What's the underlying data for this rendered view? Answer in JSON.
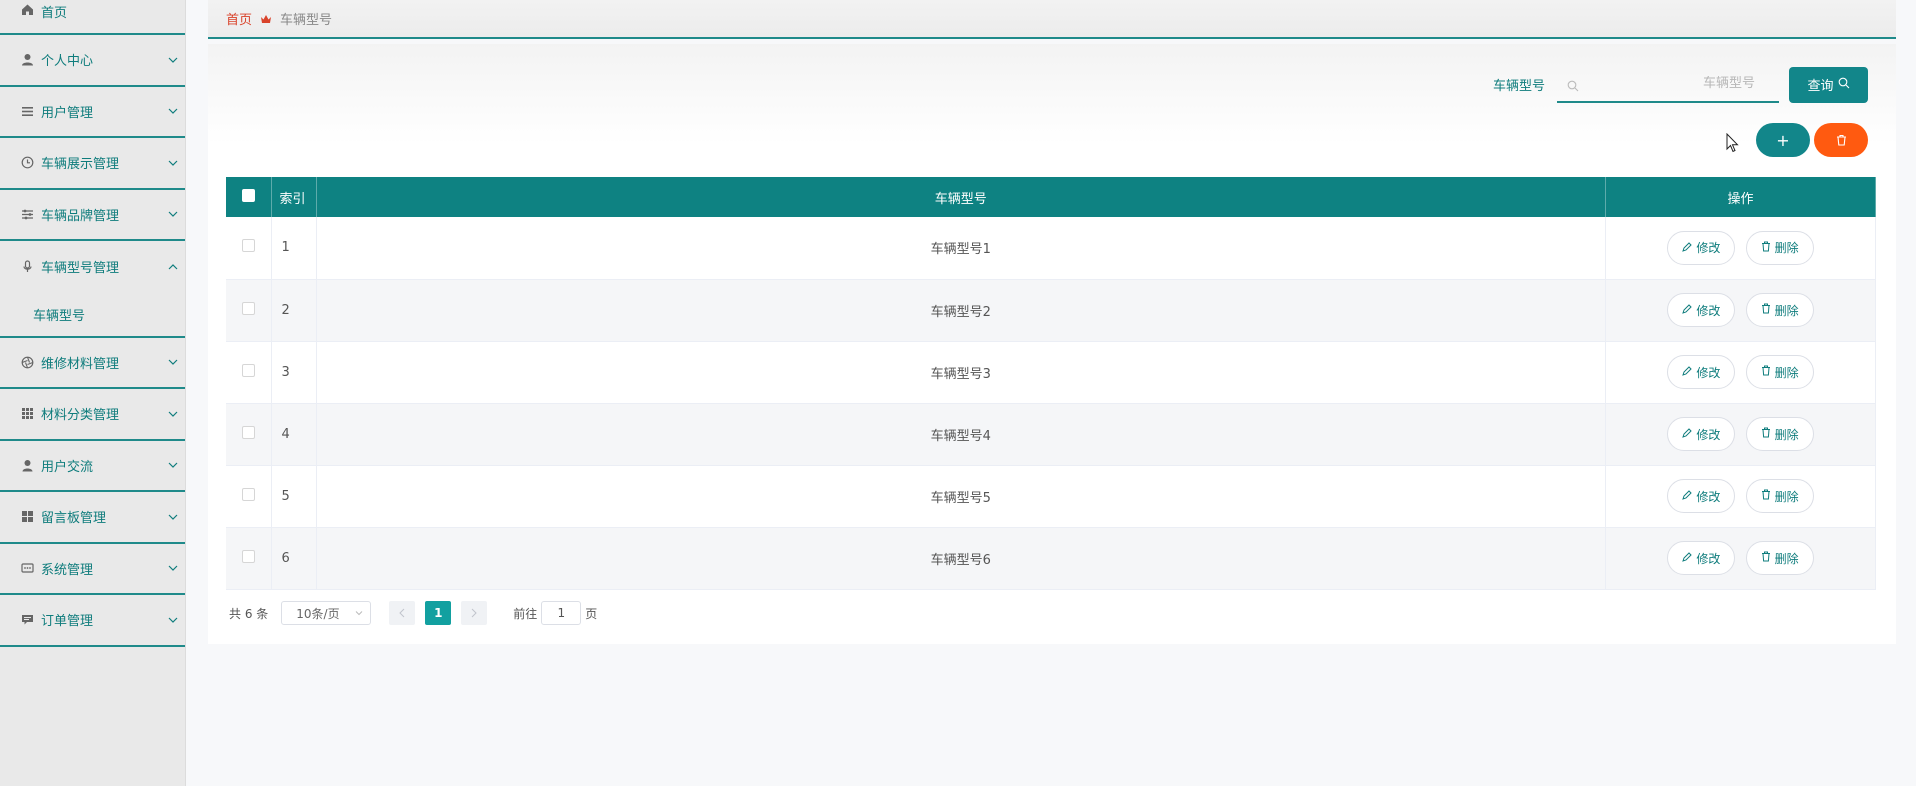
{
  "sidebar": {
    "items": [
      {
        "label": "首页",
        "icon": "home-icon"
      },
      {
        "label": "个人中心",
        "icon": "user-icon"
      },
      {
        "label": "用户管理",
        "icon": "menu-icon"
      },
      {
        "label": "车辆展示管理",
        "icon": "clock-icon"
      },
      {
        "label": "车辆品牌管理",
        "icon": "sliders-icon"
      },
      {
        "label": "车辆型号管理",
        "icon": "microphone-icon",
        "expanded": true,
        "children": [
          {
            "label": "车辆型号"
          }
        ]
      },
      {
        "label": "维修材料管理",
        "icon": "aperture-icon"
      },
      {
        "label": "材料分类管理",
        "icon": "grid-icon"
      },
      {
        "label": "用户交流",
        "icon": "person-icon"
      },
      {
        "label": "留言板管理",
        "icon": "tiles-icon"
      },
      {
        "label": "系统管理",
        "icon": "chat-box-icon"
      },
      {
        "label": "订单管理",
        "icon": "comment-icon"
      }
    ]
  },
  "breadcrumb": {
    "home": "首页",
    "current": "车辆型号"
  },
  "search": {
    "label": "车辆型号",
    "placeholder": "车辆型号",
    "button": "查询"
  },
  "actions": {
    "add": "+",
    "delete": "delete-icon"
  },
  "table": {
    "headers": {
      "index": "索引",
      "model": "车辆型号",
      "ops": "操作"
    },
    "rows": [
      {
        "index": "1",
        "model": "车辆型号1"
      },
      {
        "index": "2",
        "model": "车辆型号2"
      },
      {
        "index": "3",
        "model": "车辆型号3"
      },
      {
        "index": "4",
        "model": "车辆型号4"
      },
      {
        "index": "5",
        "model": "车辆型号5"
      },
      {
        "index": "6",
        "model": "车辆型号6"
      }
    ],
    "edit_label": "修改",
    "delete_label": "删除"
  },
  "pagination": {
    "total": "共 6 条",
    "page_size": "10条/页",
    "current": "1",
    "goto_prefix": "前往",
    "goto_value": "1",
    "goto_suffix": "页"
  },
  "colors": {
    "accent": "#0e8282",
    "danger": "#ff5a10",
    "breadcrumb_home": "#d9432b"
  }
}
